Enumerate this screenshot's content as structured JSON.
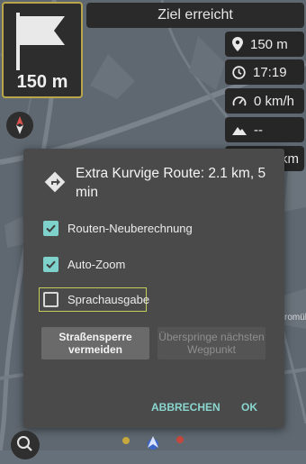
{
  "turn_widget": {
    "distance": "150 m"
  },
  "destination_bar": {
    "label": "Ziel erreicht"
  },
  "info_widgets": [
    {
      "icon": "location-pin-icon",
      "value": "150 m"
    },
    {
      "icon": "clock-icon",
      "value": "17:19"
    },
    {
      "icon": "speedometer-icon",
      "value": "0 km/h"
    },
    {
      "icon": "mountain-icon",
      "value": "--"
    },
    {
      "icon": "",
      "value": "km"
    }
  ],
  "map": {
    "place_label": "romühl"
  },
  "dialog": {
    "title": "Extra Kurvige Route: 2.1 km, 5 min",
    "options": [
      {
        "label": "Routen-Neuberechnung",
        "checked": true
      },
      {
        "label": "Auto-Zoom",
        "checked": true
      },
      {
        "label": "Sprachausgabe",
        "checked": false
      }
    ],
    "buttons": {
      "avoid_roadblock": "Straßensperre vermeiden",
      "skip_waypoint": "Überspringe nächsten Wegpunkt",
      "cancel": "ABBRECHEN",
      "ok": "OK"
    }
  },
  "colors": {
    "accent": "#7fd2cc",
    "text_button": "#8ad7d0",
    "focus_outline": "#c3cf5a",
    "dialog_bg": "#4a4a4a"
  }
}
